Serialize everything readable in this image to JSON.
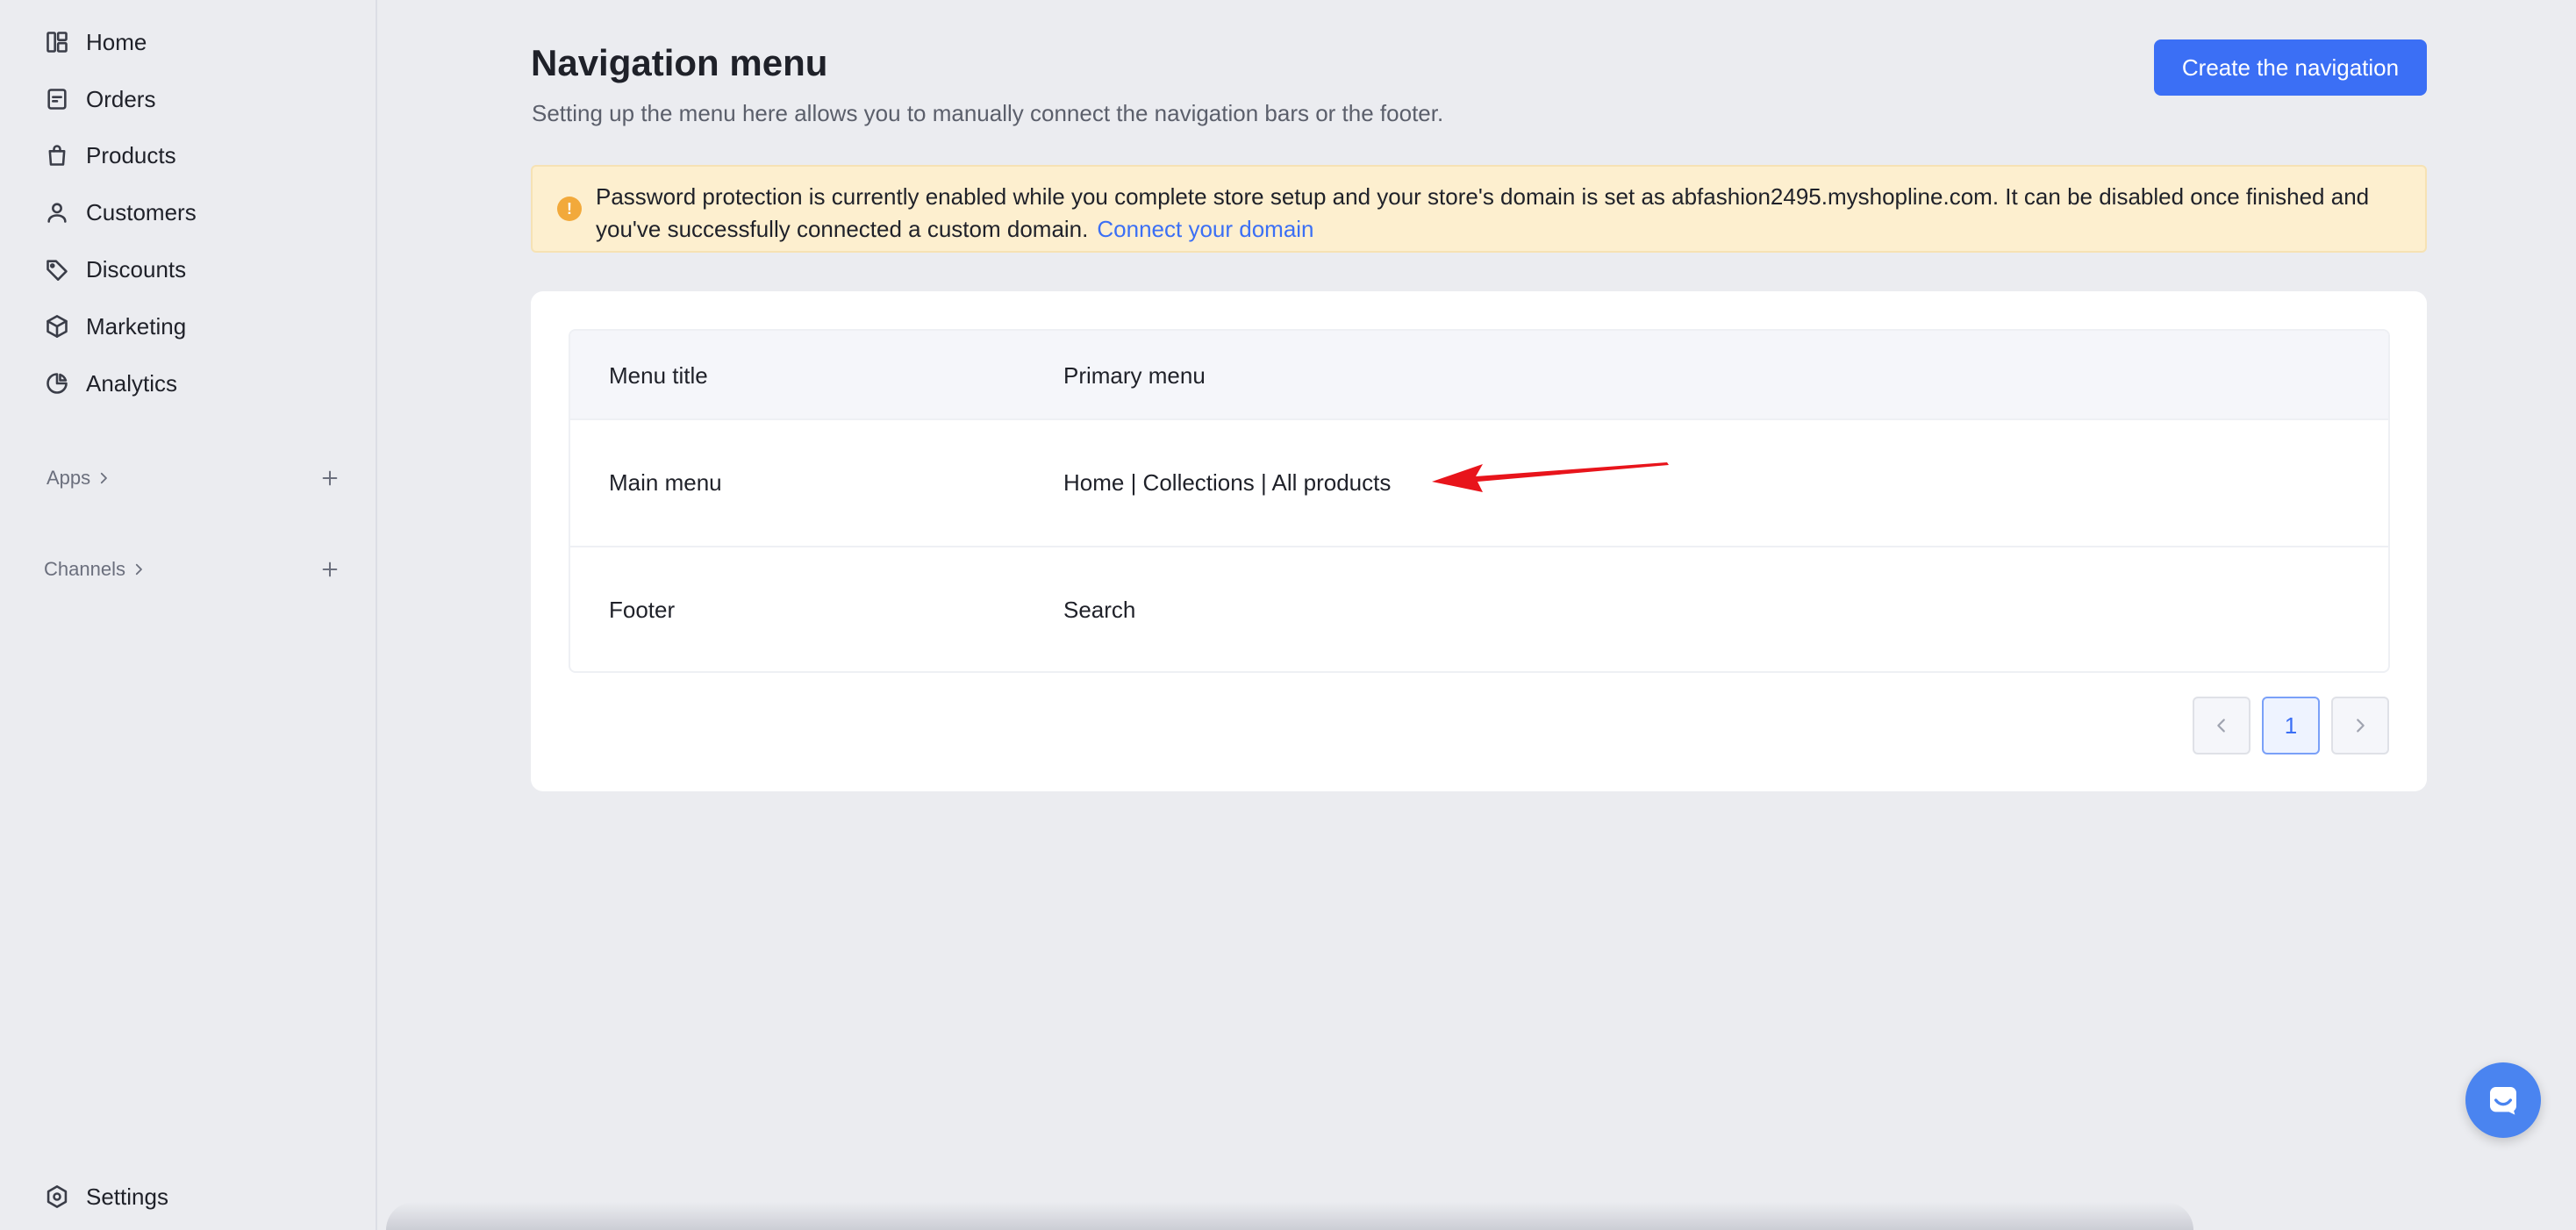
{
  "sidebar": {
    "items": [
      {
        "label": "Home",
        "icon": "dashboard-icon"
      },
      {
        "label": "Orders",
        "icon": "receipt-icon"
      },
      {
        "label": "Products",
        "icon": "shopping-bag-icon"
      },
      {
        "label": "Customers",
        "icon": "person-icon"
      },
      {
        "label": "Discounts",
        "icon": "tag-icon"
      },
      {
        "label": "Marketing",
        "icon": "cube-icon"
      },
      {
        "label": "Analytics",
        "icon": "pie-chart-icon"
      }
    ],
    "apps_label": "Apps",
    "channels_label": "Channels",
    "settings_label": "Settings"
  },
  "header": {
    "title": "Navigation menu",
    "subtitle": "Setting up the menu here allows you to manually connect the navigation bars or the footer.",
    "create_button": "Create the navigation"
  },
  "banner": {
    "message": "Password protection is currently enabled while you complete store setup and your store's domain is set as abfashion2495.myshopline.com. It can be disabled once finished and you've successfully connected a custom domain.",
    "link": "Connect your domain",
    "icon_symbol": "!"
  },
  "table": {
    "columns": [
      "Menu title",
      "Primary menu"
    ],
    "rows": [
      {
        "title": "Main menu",
        "items": "Home | Collections | All products"
      },
      {
        "title": "Footer",
        "items": "Search"
      }
    ]
  },
  "pagination": {
    "current_page": "1"
  },
  "colors": {
    "accent": "#3b6ff5",
    "banner_bg": "#fdefcf",
    "warning": "#f2a93b",
    "annotation": "#e8141b"
  }
}
